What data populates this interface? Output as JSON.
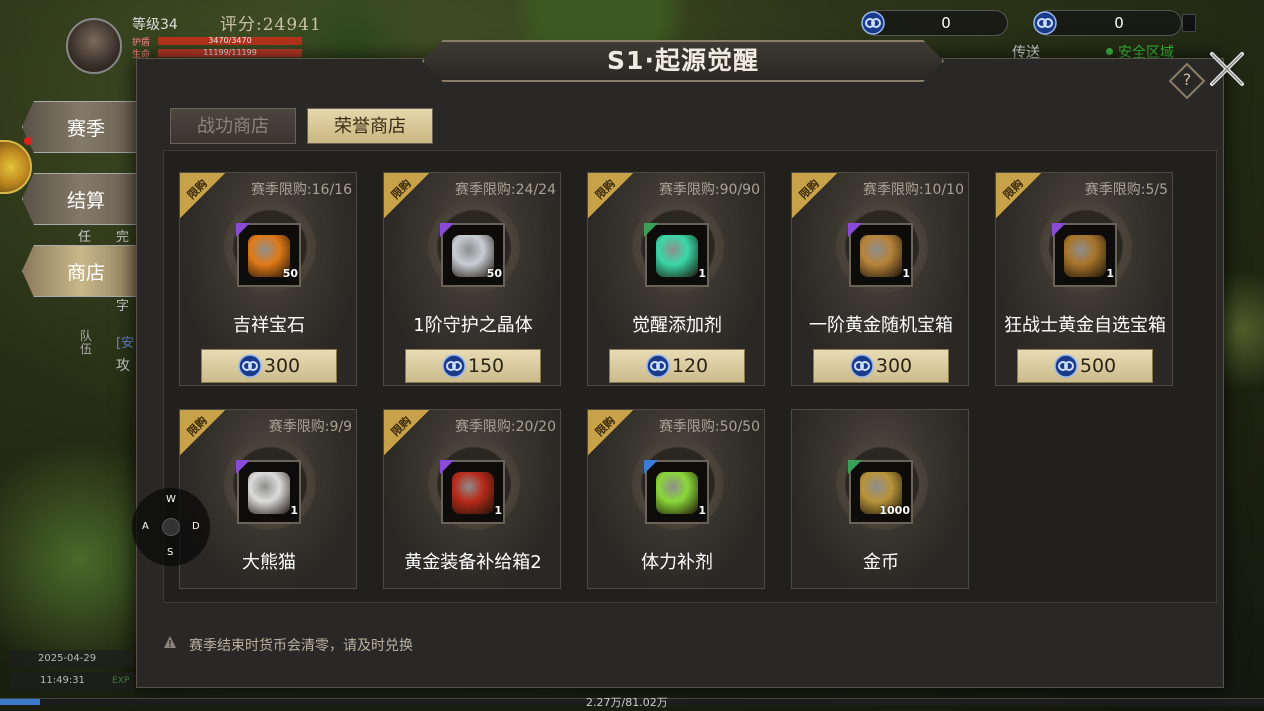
{
  "hud": {
    "level": "等级34",
    "score": "评分:24941",
    "hp_label": "护盾",
    "hp_value": "3470/3470",
    "life_label": "生命",
    "life_value": "11199/11199",
    "currency1": "0",
    "currency2": "0",
    "teleport": "传送",
    "safe_zone": "安全区域",
    "date": "2025-04-29",
    "time": "11:49:31",
    "exp_label": "EXP",
    "exp_text": "2.27万/81.02万",
    "left_texts": [
      "任",
      "完",
      "[安",
      "攻",
      "字",
      "队伍"
    ]
  },
  "side_tabs": [
    "赛季",
    "结算",
    "商店"
  ],
  "joystick": {
    "w": "W",
    "a": "A",
    "s": "S",
    "d": "D"
  },
  "modal": {
    "title": "S1·起源觉醒",
    "help": "?",
    "tabs": [
      "战功商店",
      "荣誉商店"
    ],
    "active_tab": "荣誉商店",
    "notice": "赛季结束时货币会清零，请及时兑换"
  },
  "items": [
    {
      "name": "吉祥宝石",
      "limit": "赛季限购:16/16",
      "qty": "50",
      "price": "300",
      "ribbon": "限购",
      "rarity_color": "#8a4ad8",
      "gem_color": "#e07a18"
    },
    {
      "name": "1阶守护之晶体",
      "limit": "赛季限购:24/24",
      "qty": "50",
      "price": "150",
      "ribbon": "限购",
      "rarity_color": "#8a4ad8",
      "gem_color": "#c8ccd4"
    },
    {
      "name": "觉醒添加剂",
      "limit": "赛季限购:90/90",
      "qty": "1",
      "price": "120",
      "ribbon": "限购",
      "rarity_color": "#3aa058",
      "gem_color": "#3ad8a8"
    },
    {
      "name": "一阶黄金随机宝箱",
      "limit": "赛季限购:10/10",
      "qty": "1",
      "price": "300",
      "ribbon": "限购",
      "rarity_color": "#8a4ad8",
      "gem_color": "#b8843a"
    },
    {
      "name": "狂战士黄金自选宝箱",
      "limit": "赛季限购:5/5",
      "qty": "1",
      "price": "500",
      "ribbon": "限购",
      "rarity_color": "#8a4ad8",
      "gem_color": "#a8742a"
    },
    {
      "name": "大熊猫",
      "limit": "赛季限购:9/9",
      "qty": "1",
      "price": "",
      "ribbon": "限购",
      "rarity_color": "#8a4ad8",
      "gem_color": "#dcdcdc"
    },
    {
      "name": "黄金装备补给箱2",
      "limit": "赛季限购:20/20",
      "qty": "1",
      "price": "",
      "ribbon": "限购",
      "rarity_color": "#8a4ad8",
      "gem_color": "#b82a1a"
    },
    {
      "name": "体力补剂",
      "limit": "赛季限购:50/50",
      "qty": "1",
      "price": "",
      "ribbon": "限购",
      "rarity_color": "#3a7ad8",
      "gem_color": "#8ad83a"
    },
    {
      "name": "金币",
      "limit": "",
      "qty": "1000",
      "price": "",
      "ribbon": "",
      "rarity_color": "#3aa058",
      "gem_color": "#b8943a"
    }
  ]
}
